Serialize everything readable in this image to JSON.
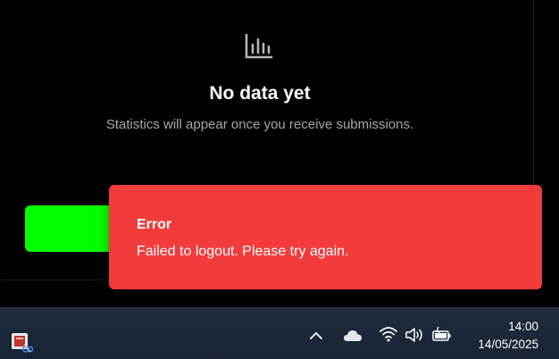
{
  "empty_state": {
    "icon": "bar-chart-icon",
    "title": "No data yet",
    "subtitle": "Statistics will appear once you receive submissions."
  },
  "action_button": {
    "color": "#00ff00"
  },
  "toast": {
    "title": "Error",
    "message": "Failed to logout. Please try again.",
    "color": "#f23c3c"
  },
  "taskbar": {
    "time": "14:00",
    "date": "14/05/2025",
    "tray_icons": [
      "chevron-up-icon",
      "onedrive-cloud-icon",
      "wifi-icon",
      "volume-icon",
      "battery-icon"
    ],
    "pinned_app_icon": "snipping-tool-icon"
  }
}
